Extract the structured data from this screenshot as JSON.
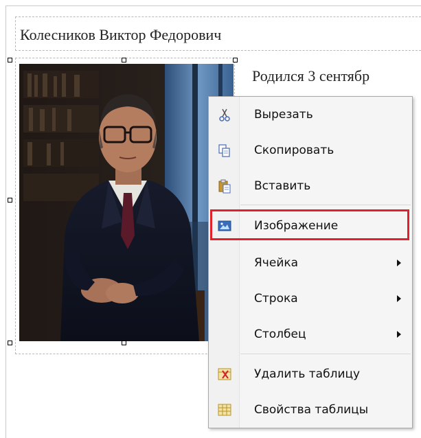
{
  "document": {
    "name": "Колесников Виктор Федорович",
    "bio_snippet": "Родился 3 сентябр"
  },
  "context_menu": {
    "items": [
      {
        "label": "Вырезать",
        "icon": "scissors-icon"
      },
      {
        "label": "Скопировать",
        "icon": "copy-icon"
      },
      {
        "label": "Вставить",
        "icon": "paste-icon"
      },
      {
        "label": "Изображение",
        "icon": "image-icon",
        "highlighted": true
      },
      {
        "label": "Ячейка",
        "submenu": true
      },
      {
        "label": "Строка",
        "submenu": true
      },
      {
        "label": "Столбец",
        "submenu": true
      },
      {
        "label": "Удалить таблицу",
        "icon": "delete-table-icon"
      },
      {
        "label": "Свойства таблицы",
        "icon": "table-properties-icon"
      }
    ]
  },
  "colors": {
    "highlight_border": "#e0202a",
    "menu_background": "#f5f5f5"
  }
}
